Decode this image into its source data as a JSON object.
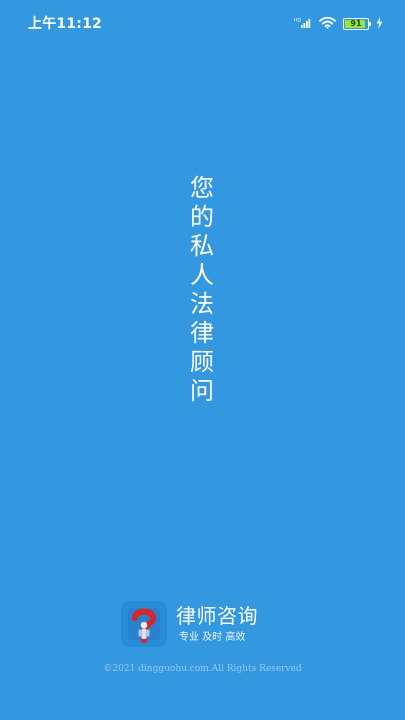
{
  "status_bar": {
    "time": "上午11:12",
    "network_label": "HD",
    "battery_level": 91,
    "battery_text": "91",
    "icons": [
      "signal-icon",
      "wifi-icon",
      "battery-icon",
      "charging-icon"
    ]
  },
  "splash": {
    "slogan": [
      "您",
      "的",
      "私",
      "人",
      "法",
      "律",
      "顾",
      "问"
    ]
  },
  "brand": {
    "app_name": "律师咨询",
    "subtitle": "专业 及时 高效",
    "logo_icon": "question-figure-logo"
  },
  "footer": {
    "copyright": "©2021 dingguohu.com.All Rights Reserved"
  },
  "colors": {
    "background": "#3498e0",
    "battery_fill": "#98e63d",
    "logo_red": "#d7262a",
    "logo_blue": "#1f6fbd",
    "copyright_text": "#96c9f1"
  }
}
